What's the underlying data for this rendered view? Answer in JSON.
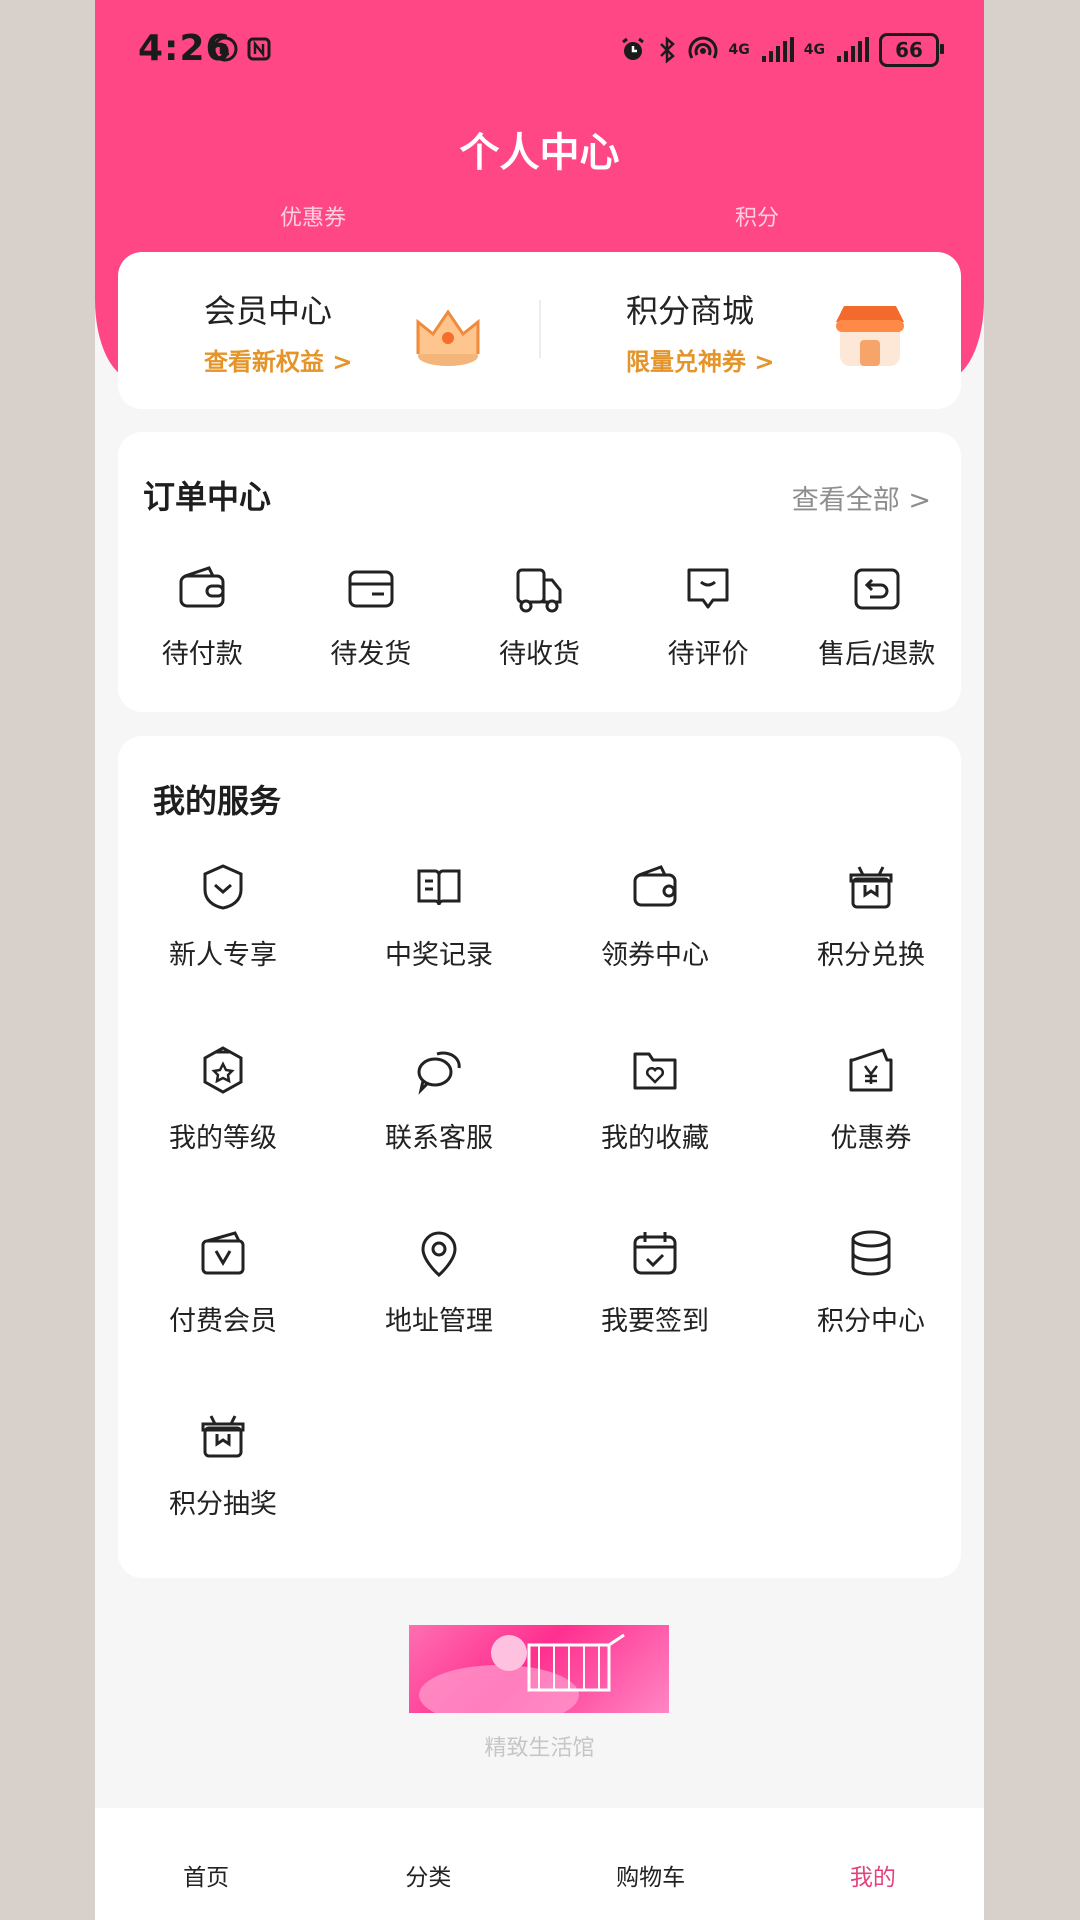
{
  "status_bar": {
    "time": "4:26",
    "battery": "66",
    "network_1": "4G",
    "network_2": "4G"
  },
  "header": {
    "title": "个人中心",
    "tabs": [
      "优惠券",
      "积分"
    ]
  },
  "promo": [
    {
      "title": "会员中心",
      "subtitle": "查看新权益 >",
      "icon": "crown-icon"
    },
    {
      "title": "积分商城",
      "subtitle": "限量兑神券 >",
      "icon": "shop-icon"
    }
  ],
  "orders": {
    "title": "订单中心",
    "view_all": "查看全部 >",
    "items": [
      {
        "label": "待付款",
        "icon": "wallet-icon"
      },
      {
        "label": "待发货",
        "icon": "card-icon"
      },
      {
        "label": "待收货",
        "icon": "truck-icon"
      },
      {
        "label": "待评价",
        "icon": "comment-icon"
      },
      {
        "label": "售后/退款",
        "icon": "return-icon"
      }
    ]
  },
  "services": {
    "title": "我的服务",
    "items": [
      {
        "label": "新人专享",
        "icon": "shield-icon"
      },
      {
        "label": "中奖记录",
        "icon": "book-icon"
      },
      {
        "label": "领券中心",
        "icon": "wallet-icon"
      },
      {
        "label": "积分兑换",
        "icon": "gift-icon"
      },
      {
        "label": "我的等级",
        "icon": "badge-icon"
      },
      {
        "label": "联系客服",
        "icon": "chat-icon"
      },
      {
        "label": "我的收藏",
        "icon": "folder-heart-icon"
      },
      {
        "label": "优惠券",
        "icon": "yen-ticket-icon"
      },
      {
        "label": "付费会员",
        "icon": "vip-box-icon"
      },
      {
        "label": "地址管理",
        "icon": "location-icon"
      },
      {
        "label": "我要签到",
        "icon": "calendar-check-icon"
      },
      {
        "label": "积分中心",
        "icon": "database-icon"
      },
      {
        "label": "积分抽奖",
        "icon": "gift-icon"
      }
    ]
  },
  "banner": {
    "caption": "精致生活馆"
  },
  "bottom_nav": [
    {
      "label": "首页",
      "active": false
    },
    {
      "label": "分类",
      "active": false
    },
    {
      "label": "购物车",
      "active": false
    },
    {
      "label": "我的",
      "active": true
    }
  ],
  "colors": {
    "brand": "#ff4785",
    "accent_orange": "#e49428",
    "nav_active": "#e2437f"
  }
}
